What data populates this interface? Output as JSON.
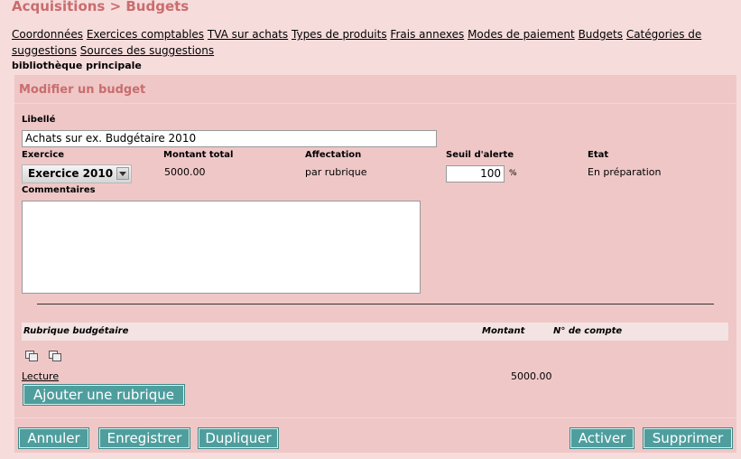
{
  "header": {
    "title": "Acquisitions > Budgets"
  },
  "nav": {
    "items": [
      "Coordonnées",
      "Exercices comptables",
      "TVA sur achats",
      "Types de produits",
      "Frais annexes",
      "Modes de paiement",
      "Budgets",
      "Catégories de suggestions",
      "Sources des suggestions"
    ]
  },
  "library": "bibliothèque principale",
  "form": {
    "title": "Modifier un budget",
    "libelle_label": "Libellé",
    "libelle_value": "Achats sur ex. Budgétaire 2010",
    "exercice_label": "Exercice",
    "exercice_value": "Exercice 2010",
    "montant_total_label": "Montant total",
    "montant_total_value": "5000.00",
    "affectation_label": "Affectation",
    "affectation_value": "par rubrique",
    "seuil_label": "Seuil d'alerte",
    "seuil_value": "100",
    "seuil_unit": "%",
    "etat_label": "Etat",
    "etat_value": "En préparation",
    "commentaires_label": "Commentaires",
    "commentaires_value": ""
  },
  "table": {
    "headers": {
      "rubrique": "Rubrique budgétaire",
      "montant": "Montant",
      "compte": "N° de compte"
    },
    "icons": [
      "expand-all-icon",
      "collapse-all-icon"
    ],
    "rows": [
      {
        "rubrique": "Lecture",
        "montant": "5000.00",
        "compte": ""
      }
    ],
    "add_button": "Ajouter une rubrique"
  },
  "actions": {
    "annuler": "Annuler",
    "enregistrer": "Enregistrer",
    "dupliquer": "Dupliquer",
    "activer": "Activer",
    "supprimer": "Supprimer"
  },
  "colors": {
    "background": "#f7dcdc",
    "panel": "#efc7c7",
    "title": "#c96d6d",
    "button": "#4f9e9e"
  }
}
